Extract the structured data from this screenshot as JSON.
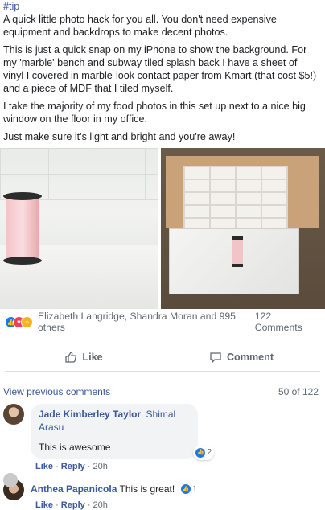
{
  "post": {
    "hashtag": "#tip",
    "paragraphs": [
      "A quick little photo hack for you all. You don't need expensive equipment and backdrops to make decent photos.",
      "This is just a quick snap on my iPhone to show the background. For my 'marble' bench and subway tiled splash back I have a sheet of vinyl I covered in marble-look contact paper from Kmart (that cost $5!) and a piece of MDF that I tiled myself.",
      "I take the majority of my food photos in this set up next to a nice big window on the floor in my office.",
      "Just make sure it's light and bright and you're away!"
    ]
  },
  "reactions": {
    "names": "Elizabeth Langridge, Shandra Moran and 995 others",
    "comments_count": "122 Comments",
    "icons": [
      "like-icon",
      "love-icon",
      "wow-icon"
    ]
  },
  "actions": {
    "like": "Like",
    "comment": "Comment"
  },
  "comments_header": {
    "view_previous": "View previous comments",
    "count": "50 of 122"
  },
  "comments": [
    {
      "author": "Jade Kimberley Taylor",
      "tag": "Shimal Arasu",
      "text": "This is awesome",
      "reactions": "2",
      "like": "Like",
      "reply": "Reply",
      "time": "20h"
    },
    {
      "author": "Anthea Papanicola",
      "text": "This is great!",
      "reactions": "1",
      "like": "Like",
      "reply": "Reply",
      "time": "20h"
    }
  ]
}
